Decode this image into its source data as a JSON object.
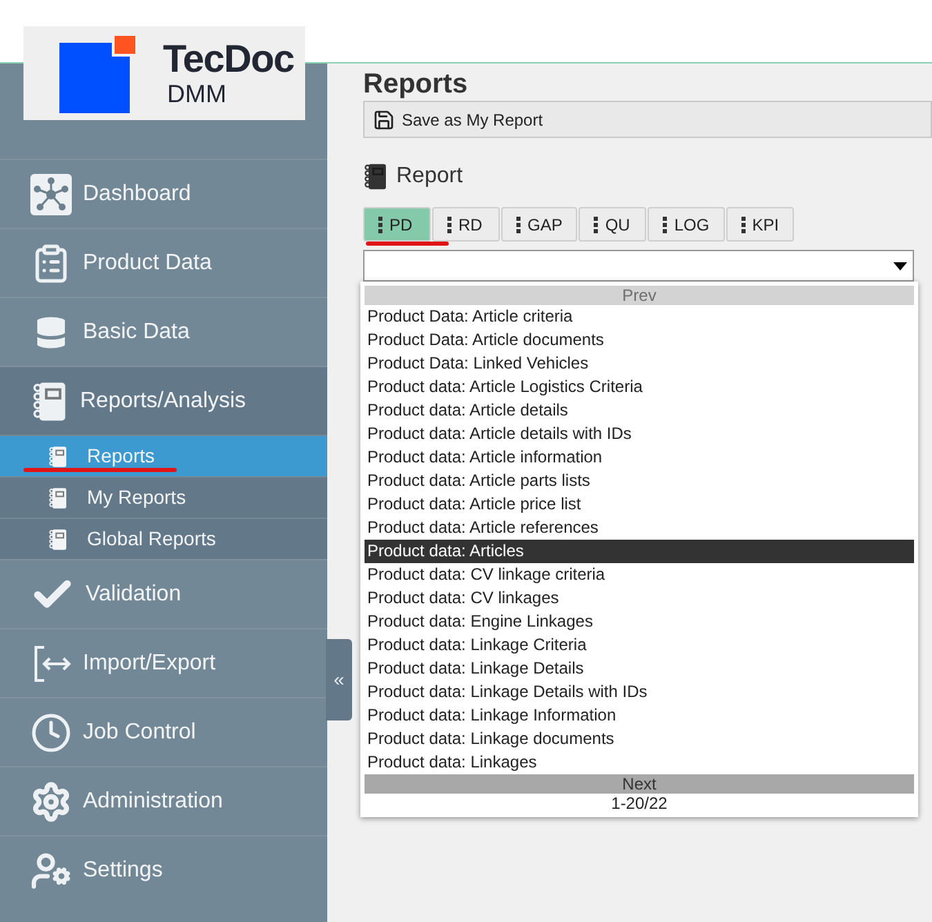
{
  "logo": {
    "name": "TecDoc",
    "sub": "DMM"
  },
  "sidebar": {
    "items": [
      {
        "label": "Dashboard",
        "selected": false
      },
      {
        "label": "Product Data",
        "selected": false
      },
      {
        "label": "Basic Data",
        "selected": false
      },
      {
        "label": "Reports/Analysis",
        "selected": false,
        "expanded": true,
        "children": [
          {
            "label": "Reports",
            "selected": true
          },
          {
            "label": "My Reports",
            "selected": false
          },
          {
            "label": "Global Reports",
            "selected": false
          }
        ]
      },
      {
        "label": "Validation",
        "selected": false
      },
      {
        "label": "Import/Export",
        "selected": false
      },
      {
        "label": "Job Control",
        "selected": false
      },
      {
        "label": "Administration",
        "selected": false
      },
      {
        "label": "Settings",
        "selected": false
      }
    ],
    "collapse": "«"
  },
  "page": {
    "title": "Reports",
    "toolbar": {
      "save": "Save as My Report"
    },
    "section": "Report"
  },
  "tabs": [
    {
      "label": "PD",
      "selected": true
    },
    {
      "label": "RD",
      "selected": false
    },
    {
      "label": "GAP",
      "selected": false
    },
    {
      "label": "QU",
      "selected": false
    },
    {
      "label": "LOG",
      "selected": false
    },
    {
      "label": "KPI",
      "selected": false
    }
  ],
  "dropdown": {
    "prev": "Prev",
    "next": "Next",
    "count": "1-20/22",
    "options": [
      {
        "label": "Product Data: Article criteria",
        "selected": false
      },
      {
        "label": "Product Data: Article documents",
        "selected": false
      },
      {
        "label": "Product Data: Linked Vehicles",
        "selected": false
      },
      {
        "label": "Product data: Article Logistics Criteria",
        "selected": false
      },
      {
        "label": "Product data: Article details",
        "selected": false
      },
      {
        "label": "Product data: Article details with IDs",
        "selected": false
      },
      {
        "label": "Product data: Article information",
        "selected": false
      },
      {
        "label": "Product data: Article parts lists",
        "selected": false
      },
      {
        "label": "Product data: Article price list",
        "selected": false
      },
      {
        "label": "Product data: Article references",
        "selected": false
      },
      {
        "label": "Product data: Articles",
        "selected": true
      },
      {
        "label": "Product data: CV linkage criteria",
        "selected": false
      },
      {
        "label": "Product data: CV linkages",
        "selected": false
      },
      {
        "label": "Product data: Engine Linkages",
        "selected": false
      },
      {
        "label": "Product data: Linkage Criteria",
        "selected": false
      },
      {
        "label": "Product data: Linkage Details",
        "selected": false
      },
      {
        "label": "Product data: Linkage Details with IDs",
        "selected": false
      },
      {
        "label": "Product data: Linkage Information",
        "selected": false
      },
      {
        "label": "Product data: Linkage documents",
        "selected": false
      },
      {
        "label": "Product data: Linkages",
        "selected": false
      }
    ]
  }
}
